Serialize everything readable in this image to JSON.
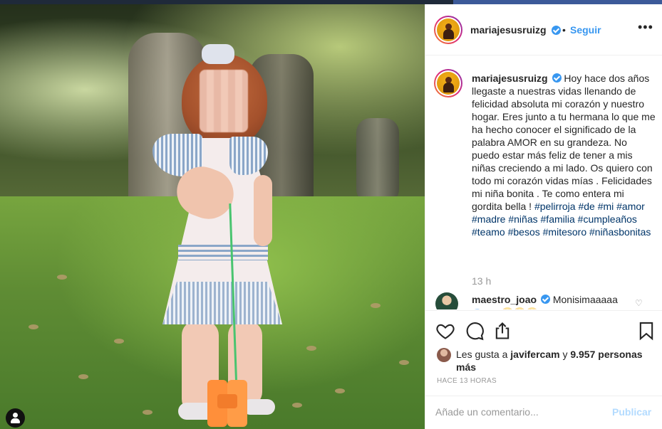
{
  "post": {
    "username": "mariajesusruizg",
    "dot": "•",
    "follow_label": "Seguir",
    "more_label": "•••"
  },
  "caption": {
    "username": "mariajesusruizg",
    "text": "Hoy hace dos años llegaste a nuestras vidas llenando de felicidad absoluta mi corazón y nuestro hogar. Eres junto a tu hermana lo que me ha hecho conocer el significado de la palabra AMOR en su grandeza. No puedo estar más feliz de tener a mis niñas creciendo a mi lado. Os quiero con todo mi corazón vidas mías . Felicidades mi niña bonita . Te como entera mi gordita bella !",
    "hashtags": [
      "#pelirroja",
      "#de",
      "#mi",
      "#amor",
      "#madre",
      "#niñas",
      "#familia",
      "#cumpleaños",
      "#teamo",
      "#besos",
      "#mitesoro",
      "#niñasbonitas"
    ],
    "time": "13 h"
  },
  "comment": {
    "username": "maestro_joao",
    "text": "Monisimaaaaa",
    "sub": "@ ..... 😍😍😍"
  },
  "likes": {
    "prefix": "Les gusta a",
    "user": "javifercam",
    "conj": "y",
    "count": "9.957 personas más"
  },
  "timestamp": "HACE 13 HORAS",
  "add_comment": {
    "placeholder": "Añade un comentario...",
    "publish_label": "Publicar"
  },
  "icons": {
    "like": "heart-icon",
    "comment": "comment-icon",
    "share": "share-icon",
    "save": "bookmark-icon",
    "verified": "verified-badge-icon",
    "user_tag": "user-tag-icon"
  },
  "colors": {
    "link_blue": "#3897f0",
    "hashtag": "#003569",
    "muted": "#999999"
  }
}
